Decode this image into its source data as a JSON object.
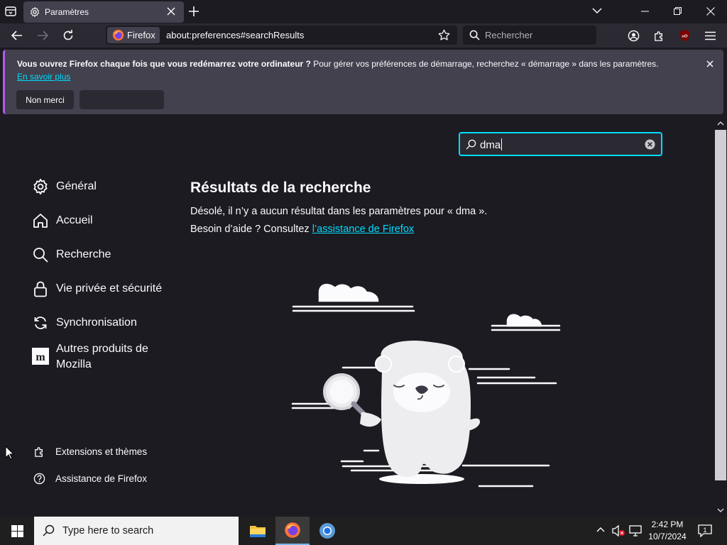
{
  "tab": {
    "title": "Paramètres"
  },
  "navbar": {
    "identity_label": "Firefox",
    "url": "about:preferences#searchResults",
    "search_placeholder": "Rechercher"
  },
  "notification": {
    "bold_text": "Vous ouvrez Firefox chaque fois que vous redémarrez votre ordinateur ?",
    "text": " Pour gérer vos préférences de démarrage, recherchez « démarrage » dans les paramètres.",
    "link": "En savoir plus",
    "button_no": "Non merci"
  },
  "preferences": {
    "search_value": "dma",
    "categories": [
      {
        "label": "Général",
        "icon": "gear-icon"
      },
      {
        "label": "Accueil",
        "icon": "home-icon"
      },
      {
        "label": "Recherche",
        "icon": "search-icon"
      },
      {
        "label": "Vie privée et sécurité",
        "icon": "lock-icon"
      },
      {
        "label": "Synchronisation",
        "icon": "sync-icon"
      },
      {
        "label": "Autres produits de Mozilla",
        "icon": "mozilla-icon"
      }
    ],
    "footer": [
      {
        "label": "Extensions et thèmes",
        "icon": "puzzle-icon"
      },
      {
        "label": "Assistance de Firefox",
        "icon": "help-icon"
      }
    ],
    "result_title": "Résultats de la recherche",
    "no_result_text": "Désolé, il n’y a aucun résultat dans les paramètres pour « dma ».",
    "help_prefix": "Besoin d’aide ? Consultez ",
    "help_link": "l’assistance de Firefox"
  },
  "taskbar": {
    "search_placeholder": "Type here to search",
    "time": "2:42 PM",
    "date": "10/7/2024"
  },
  "colors": {
    "accent": "#00ddff",
    "background": "#1c1b22",
    "toolbar": "#2b2a33",
    "notification": "#42414d"
  }
}
